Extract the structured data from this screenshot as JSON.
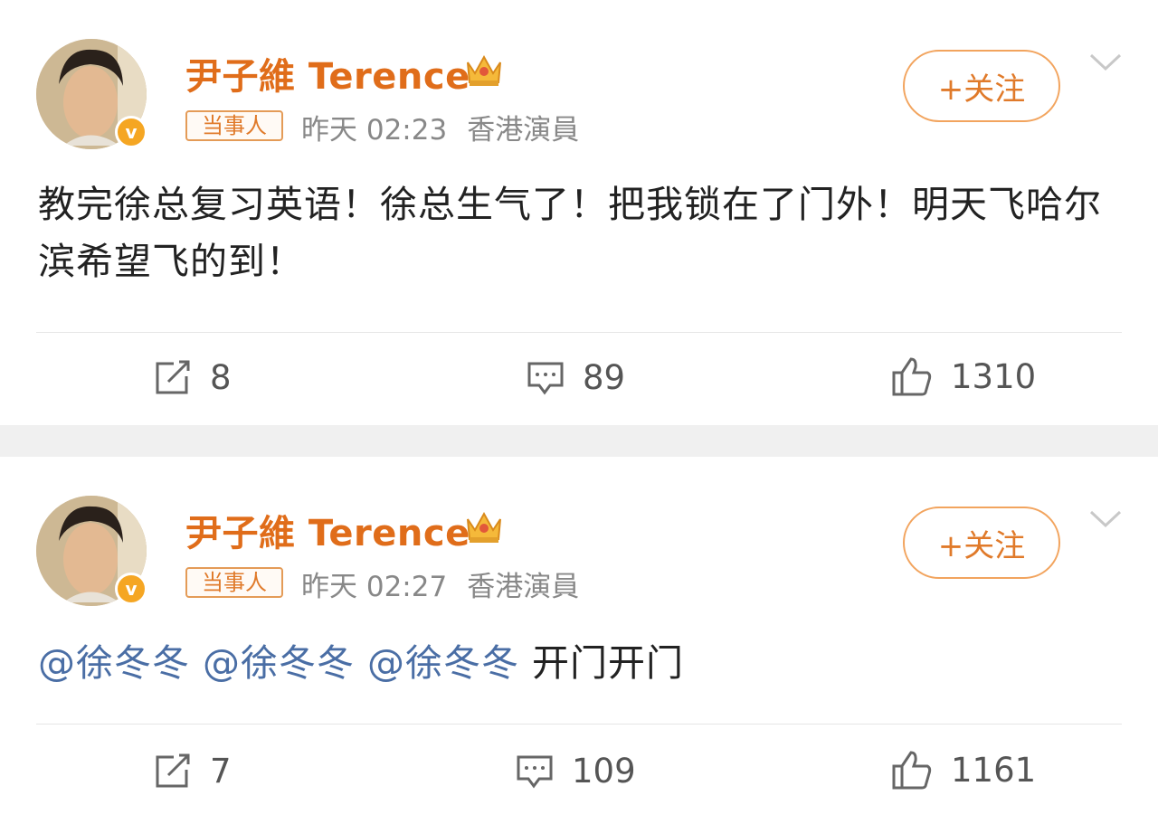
{
  "posts": [
    {
      "author": "尹子維 Terence",
      "badge": "当事人",
      "time": "昨天 02:23",
      "source": "香港演員",
      "follow_label": "+关注",
      "text": "教完徐总复习英语！徐总生气了！把我锁在了门外！明天飞哈尔滨希望飞的到！",
      "reposts": "8",
      "comments": "89",
      "likes": "1310"
    },
    {
      "author": "尹子維 Terence",
      "badge": "当事人",
      "time": "昨天 02:27",
      "source": "香港演員",
      "follow_label": "+关注",
      "mentions": [
        "@徐冬冬",
        "@徐冬冬",
        "@徐冬冬"
      ],
      "text": "开门开门",
      "reposts": "7",
      "comments": "109",
      "likes": "1161"
    }
  ],
  "colors": {
    "author_name": "#e06d1a",
    "mention": "#4a6ea5",
    "meta": "#888888",
    "follow_border": "#f2a45e",
    "separator": "#f0f0f0"
  },
  "icons": {
    "verified": "verified-v-icon",
    "crown": "crown-icon",
    "repost": "repost-icon",
    "comment": "comment-icon",
    "like": "like-icon",
    "menu": "chevron-down-icon"
  }
}
